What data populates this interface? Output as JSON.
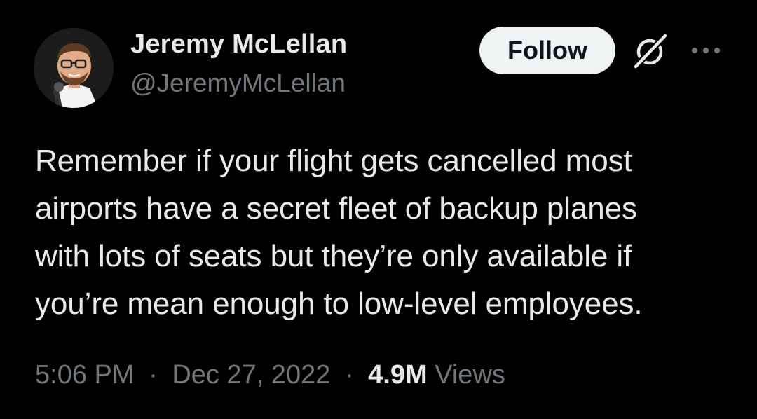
{
  "author": {
    "name": "Jeremy McLellan",
    "handle": "@JeremyMcLellan"
  },
  "follow_button": {
    "label": "Follow"
  },
  "icons": {
    "avatar": "profile-photo",
    "grok": "grok-icon",
    "more": "more-horizontal-icon"
  },
  "tweet": {
    "text_lines": [
      "Remember if your flight gets cancelled most",
      "airports have a secret fleet of backup planes",
      "with lots of seats but they’re only available if",
      "you’re mean enough to low-level employees."
    ]
  },
  "meta": {
    "time": "5:06 PM",
    "separator": "·",
    "date": "Dec 27, 2022",
    "views_count": "4.9M",
    "views_label": "Views"
  },
  "colors": {
    "background": "#000000",
    "primary_text": "#e7e9ea",
    "secondary_text": "#71767b",
    "follow_bg": "#eff3f4",
    "follow_text": "#0f1419"
  }
}
